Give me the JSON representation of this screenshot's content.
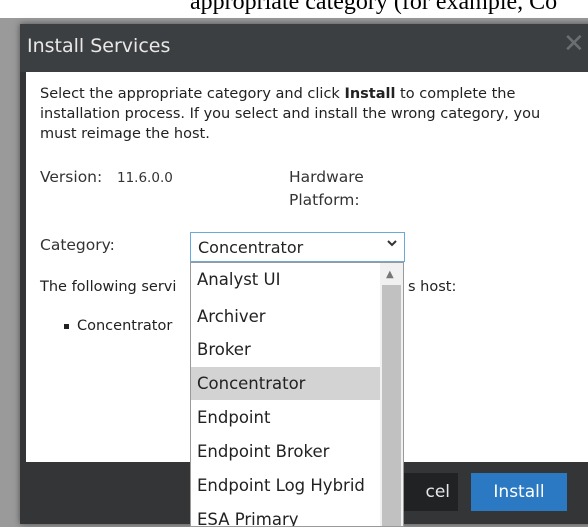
{
  "background": {
    "top_text": "appropriate category (for example, Co"
  },
  "dialog": {
    "title": "Install Services",
    "intro_prefix": "Select the appropriate category and click ",
    "intro_bold": "Install",
    "intro_suffix": " to complete the installation process. If you select and install the wrong category, you must reimage the host.",
    "version_label": "Version:",
    "version_value": "11.6.0.0",
    "hardware_label_line1": "Hardware",
    "hardware_label_line2": "Platform:",
    "category_label": "Category:",
    "category_selected": "Concentrator",
    "following_text_left": "The following servi",
    "following_text_right": "s host:",
    "service_bullet": "Concentrator"
  },
  "dropdown": {
    "options": [
      "Analyst UI",
      "Archiver",
      "Broker",
      "Concentrator",
      "Endpoint",
      "Endpoint Broker",
      "Endpoint Log Hybrid",
      "ESA Primary"
    ],
    "selected_index": 3
  },
  "buttons": {
    "cancel_label": "cel",
    "install_label": "Install"
  },
  "colors": {
    "accent": "#2a79c2",
    "dialog_bg": "#333537",
    "select_border": "#6aa9d8"
  }
}
